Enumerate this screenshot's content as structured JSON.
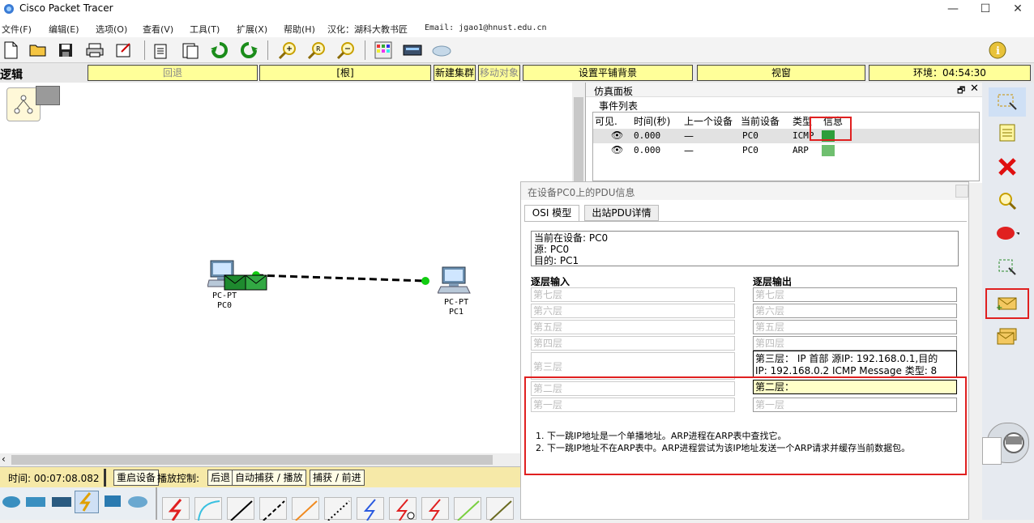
{
  "window": {
    "title": "Cisco Packet Tracer"
  },
  "menu": [
    "文件(F)",
    "编辑(E)",
    "选项(O)",
    "查看(V)",
    "工具(T)",
    "扩展(X)",
    "帮助(H)",
    "汉化：湖科大教书匠",
    "Email: jgao1@hnust.edu.cn"
  ],
  "logicbar": {
    "mode": "逻辑",
    "back": "回退",
    "root": "[根]",
    "new_cluster": "新建集群",
    "move_object": "移动对象",
    "set_background": "设置平铺背景",
    "viewport": "视窗",
    "environment": "环境：04:54:30"
  },
  "canvas": {
    "pc0": {
      "type": "PC-PT",
      "name": "PC0"
    },
    "pc1": {
      "type": "PC-PT",
      "name": "PC1"
    }
  },
  "sim_panel": {
    "title": "仿真面板",
    "event_list": "事件列表",
    "columns": [
      "可见.",
      "时间(秒)",
      "上一个设备",
      "当前设备",
      "类型",
      "信息"
    ],
    "events": [
      {
        "time": "0.000",
        "last": "—",
        "current": "PC0",
        "type": "ICMP",
        "color": "#2e9e3a"
      },
      {
        "time": "0.000",
        "last": "—",
        "current": "PC0",
        "type": "ARP",
        "color": "#6fbf6f"
      }
    ]
  },
  "pdu": {
    "title": "在设备PC0上的PDU信息",
    "tabs": [
      "OSI 模型",
      "出站PDU详情"
    ],
    "info": [
      "当前在设备: PC0",
      "源: PC0",
      "目的: PC1"
    ],
    "in_header": "逐层输入",
    "out_header": "逐层输出",
    "in_layers": [
      "第七层",
      "第六层",
      "第五层",
      "第四层",
      "第三层",
      "第二层",
      "第一层"
    ],
    "out_layers": [
      "第七层",
      "第六层",
      "第五层",
      "第四层"
    ],
    "out_layer3_line1": "第三层： IP 首部 源IP: 192.168.0.1,目的",
    "out_layer3_line2": "IP: 192.168.0.2 ICMP Message 类型: 8",
    "out_layer2": "第二层：",
    "out_layer1": "第一层",
    "notes": [
      "1. 下一跳IP地址是一个单播地址。ARP进程在ARP表中查找它。",
      "2. 下一跳IP地址不在ARP表中。ARP进程尝试为该IP地址发送一个ARP请求并缓存当前数据包。"
    ]
  },
  "status": {
    "time": "时间: 00:07:08.082",
    "reset": "重启设备",
    "play_control": "播放控制:",
    "back": "后退",
    "auto_capture": "自动捕获 / 播放",
    "capture_forward": "捕获 / 前进"
  },
  "colors": {
    "highlight_red": "#e02020",
    "button_yellow": "#ffff99",
    "status_yellow": "#f6e9a8"
  }
}
